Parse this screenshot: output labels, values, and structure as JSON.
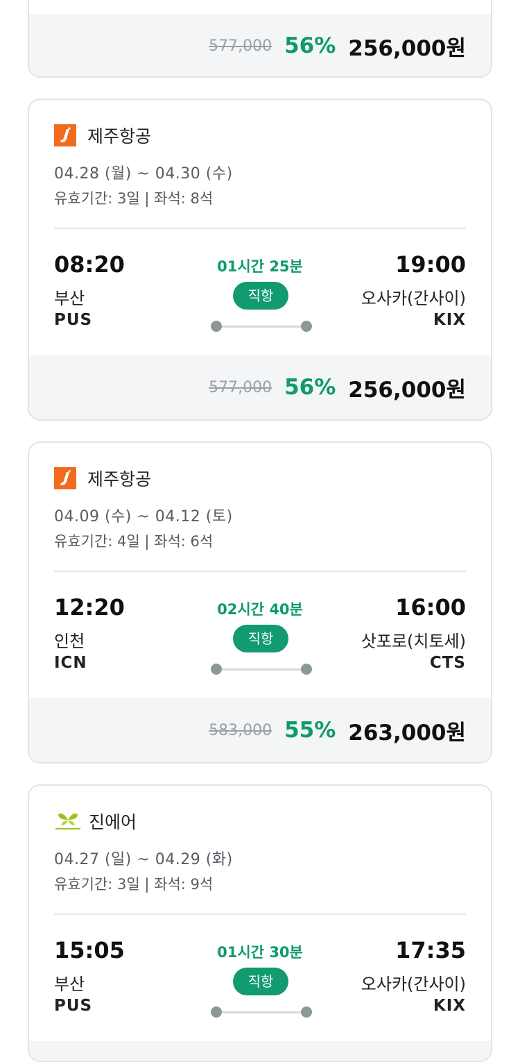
{
  "top_card": {
    "original_price": "577,000",
    "discount": "56%",
    "price": "256,000원"
  },
  "flights": [
    {
      "airline": "제주항공",
      "airline_logo": "jeju-air-logo",
      "dates": "04.28 (월) ~ 04.30 (수)",
      "meta": "유효기간: 3일 | 좌석: 8석",
      "departure_time": "08:20",
      "arrival_time": "19:00",
      "duration": "01시간 25분",
      "direct_label": "직항",
      "departure_city": "부산",
      "arrival_city": "오사카(간사이)",
      "departure_code": "PUS",
      "arrival_code": "KIX",
      "original_price": "577,000",
      "discount": "56%",
      "price": "256,000원"
    },
    {
      "airline": "제주항공",
      "airline_logo": "jeju-air-logo",
      "dates": "04.09 (수) ~ 04.12 (토)",
      "meta": "유효기간: 4일 | 좌석: 6석",
      "departure_time": "12:20",
      "arrival_time": "16:00",
      "duration": "02시간 40분",
      "direct_label": "직항",
      "departure_city": "인천",
      "arrival_city": "삿포로(치토세)",
      "departure_code": "ICN",
      "arrival_code": "CTS",
      "original_price": "583,000",
      "discount": "55%",
      "price": "263,000원"
    },
    {
      "airline": "진에어",
      "airline_logo": "jin-air-logo",
      "dates": "04.27 (일) ~ 04.29 (화)",
      "meta": "유효기간: 3일 | 좌석: 9석",
      "departure_time": "15:05",
      "arrival_time": "17:35",
      "duration": "01시간 30분",
      "direct_label": "직항",
      "departure_city": "부산",
      "arrival_city": "오사카(간사이)",
      "departure_code": "PUS",
      "arrival_code": "KIX"
    }
  ],
  "colors": {
    "accent_green": "#0f9a6c",
    "badge_green": "#129a70",
    "jeju_orange": "#f26b1d",
    "jinair_green": "#9bc31e"
  }
}
